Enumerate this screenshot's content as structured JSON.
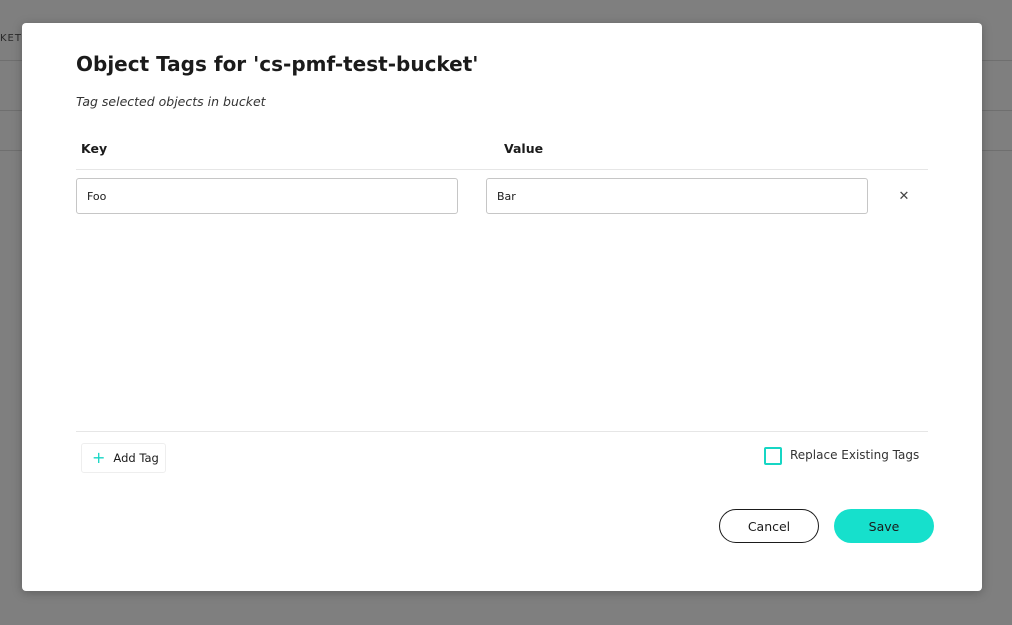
{
  "background": {
    "truncated_label": "KET C"
  },
  "modal": {
    "title": "Object Tags for 'cs-pmf-test-bucket'",
    "subtitle": "Tag selected objects in bucket",
    "columns": {
      "key": "Key",
      "value": "Value"
    },
    "tags": [
      {
        "key": "Foo",
        "value": "Bar"
      }
    ],
    "remove_icon": "close-icon",
    "add_tag_label": "Add Tag",
    "add_icon": "plus-icon",
    "replace_existing_label": "Replace Existing Tags",
    "replace_existing_checked": false,
    "cancel_label": "Cancel",
    "save_label": "Save"
  },
  "colors": {
    "accent": "#16e0cc",
    "overlay": "#7f7f7f"
  }
}
